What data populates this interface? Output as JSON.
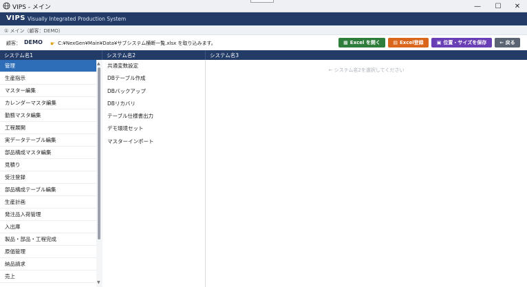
{
  "window": {
    "title": "VIPS - メイン",
    "minimize": "—",
    "maximize": "☐",
    "close": "✕"
  },
  "app": {
    "brand": "VIPS",
    "subtitle": "Visually Integrated Production System"
  },
  "breadcrumb": "① メイン（顧客：DEMO）",
  "toolbar": {
    "customer_label": "顧客：",
    "customer_value": "DEMO",
    "file_text": "C:¥NexGen¥Main¥Data¥サブシステム横断一覧.xlsx を取り込みます。",
    "buttons": [
      {
        "label": "Excel を開く",
        "color": "#2e7d3a"
      },
      {
        "label": "Excel登録",
        "color": "#d9661b"
      },
      {
        "label": "位置・サイズを保存",
        "color": "#6a3fb5"
      },
      {
        "label": "← 戻る",
        "color": "#5b6472"
      }
    ]
  },
  "columns": {
    "col1_header": "システム名1",
    "col2_header": "システム名2",
    "col3_header": "システム名3"
  },
  "col1_items": [
    "管理",
    "生産指示",
    "マスター編集",
    "カレンダーマスタ編集",
    "勤務マスタ編集",
    "工程展開",
    "実データテーブル編集",
    "部品構成マスタ編集",
    "見積り",
    "受注登録",
    "部品構成テーブル編集",
    "生産計画",
    "発注品入荷管理",
    "入出庫",
    "製品・部品・工程完成",
    "原価管理",
    "納品請求",
    "売上"
  ],
  "col2_items": [
    "共通変数設定",
    "DBテーブル作成",
    "DBバックアップ",
    "DBリカバリ",
    "テーブル仕様書出力",
    "デモ環境セット",
    "マスターインポート"
  ],
  "col3_hint": "← システム名2を選択してください"
}
